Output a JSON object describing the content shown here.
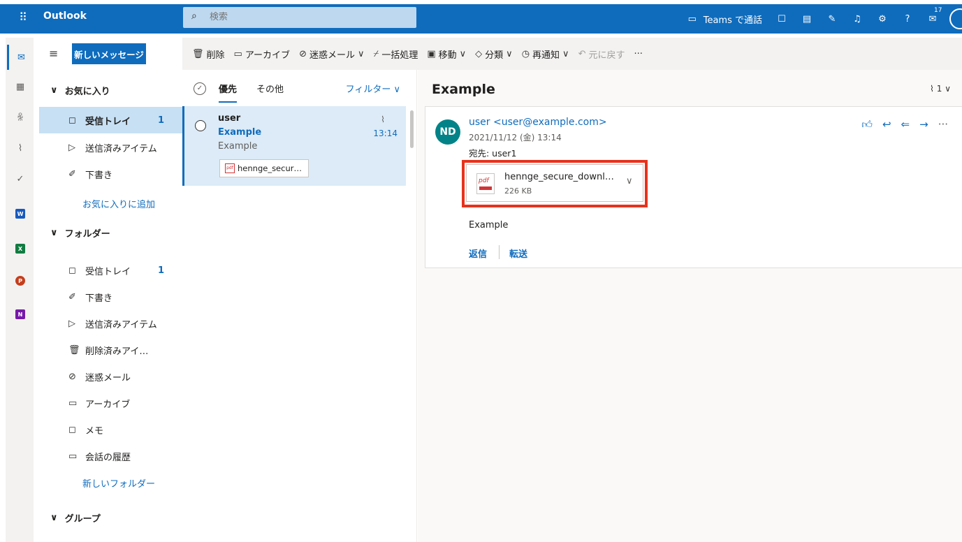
{
  "topbar": {
    "app_name": "Outlook",
    "search_placeholder": "検索",
    "teams_label": "Teams で通話",
    "badge_count": "17"
  },
  "compose": {
    "new_message": "新しいメッセージ"
  },
  "favorites": {
    "header": "お気に入り",
    "items": [
      {
        "label": "受信トレイ",
        "count": "1"
      },
      {
        "label": "送信済みアイテム"
      },
      {
        "label": "下書き"
      }
    ],
    "add_link": "お気に入りに追加"
  },
  "folders": {
    "header": "フォルダー",
    "items": [
      {
        "label": "受信トレイ",
        "count": "1"
      },
      {
        "label": "下書き"
      },
      {
        "label": "送信済みアイテム"
      },
      {
        "label": "削除済みアイ…"
      },
      {
        "label": "迷惑メール"
      },
      {
        "label": "アーカイブ"
      },
      {
        "label": "メモ"
      },
      {
        "label": "会話の履歴"
      }
    ],
    "new_folder_link": "新しいフォルダー"
  },
  "groups": {
    "header": "グループ"
  },
  "commands": {
    "delete": "削除",
    "archive": "アーカイブ",
    "junk": "迷惑メール",
    "sweep": "一括処理",
    "move": "移動",
    "categorize": "分類",
    "snooze": "再通知",
    "undo": "元に戻す"
  },
  "message_list": {
    "tab_focused": "優先",
    "tab_other": "その他",
    "filter": "フィルター",
    "items": [
      {
        "from": "user",
        "subject": "Example",
        "preview": "Example",
        "time": "13:14",
        "attachment": "hennge_secur…"
      }
    ]
  },
  "reading": {
    "subject": "Example",
    "attachment_count": "1",
    "avatar_initials": "ND",
    "from": "user <user@example.com>",
    "date": "2021/11/12 (金) 13:14",
    "to": "宛先: user1",
    "attachment": {
      "name": "hennge_secure_downl…",
      "size": "226 KB"
    },
    "body": "Example",
    "reply": "返信",
    "forward": "転送"
  },
  "colors": {
    "accent": "#0f6cbd",
    "highlight": "#e8321c",
    "avatar": "#038387"
  }
}
